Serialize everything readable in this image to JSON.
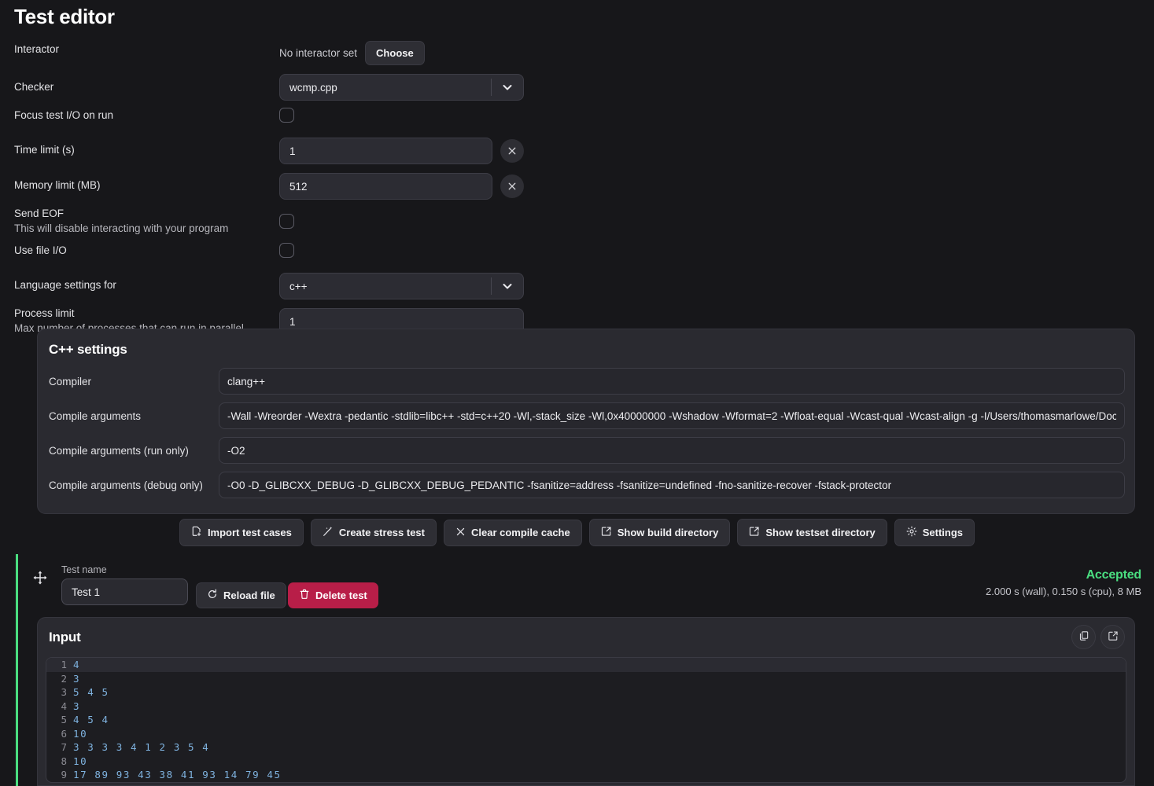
{
  "page": {
    "title": "Test editor"
  },
  "settings": {
    "interactor": {
      "label": "Interactor",
      "status": "No interactor set",
      "choose_label": "Choose"
    },
    "checker": {
      "label": "Checker",
      "value": "wcmp.cpp"
    },
    "focus_io": {
      "label": "Focus test I/O on run",
      "checked": false
    },
    "time_limit": {
      "label": "Time limit (s)",
      "value": "1"
    },
    "memory_limit": {
      "label": "Memory limit (MB)",
      "value": "512"
    },
    "send_eof": {
      "label": "Send EOF",
      "sub": "This will disable interacting with your program",
      "checked": false
    },
    "use_file_io": {
      "label": "Use file I/O",
      "checked": false
    },
    "language_settings": {
      "label": "Language settings for",
      "value": "c++"
    },
    "process_limit": {
      "label": "Process limit",
      "sub": "Max number of processes that can run in parallel",
      "value": "1"
    }
  },
  "cpp_settings": {
    "title": "C++ settings",
    "rows": [
      {
        "label": "Compiler",
        "value": "clang++"
      },
      {
        "label": "Compile arguments",
        "value": "-Wall -Wreorder -Wextra -pedantic -stdlib=libc++ -std=c++20 -Wl,-stack_size -Wl,0x40000000 -Wshadow -Wformat=2 -Wfloat-equal -Wcast-qual -Wcast-align -g -I/Users/thomasmarlowe/Doc"
      },
      {
        "label": "Compile arguments (run only)",
        "value": "-O2"
      },
      {
        "label": "Compile arguments (debug only)",
        "value": "-O0 -D_GLIBCXX_DEBUG -D_GLIBCXX_DEBUG_PEDANTIC -fsanitize=address -fsanitize=undefined -fno-sanitize-recover -fstack-protector"
      }
    ]
  },
  "toolbar": {
    "import_label": "Import test cases",
    "stress_label": "Create stress test",
    "clear_cache_label": "Clear compile cache",
    "build_dir_label": "Show build directory",
    "testset_dir_label": "Show testset directory",
    "settings_label": "Settings"
  },
  "test": {
    "name_label": "Test name",
    "name_value": "Test 1",
    "reload_label": "Reload file",
    "delete_label": "Delete test",
    "verdict": "Accepted",
    "verdict_color": "#4ade80",
    "timing": "2.000 s (wall), 0.150 s (cpu), 8 MB"
  },
  "input_panel": {
    "title": "Input",
    "lines": [
      {
        "n": "1",
        "text": "4"
      },
      {
        "n": "2",
        "text": "3"
      },
      {
        "n": "3",
        "text": "5 4 5"
      },
      {
        "n": "4",
        "text": "3"
      },
      {
        "n": "5",
        "text": "4 5 4"
      },
      {
        "n": "6",
        "text": "10"
      },
      {
        "n": "7",
        "text": "3 3 3 3 4 1 2 3 5 4"
      },
      {
        "n": "8",
        "text": "10"
      },
      {
        "n": "9",
        "text": "17 89 93 43 38 41 93 14 79 45"
      }
    ]
  }
}
